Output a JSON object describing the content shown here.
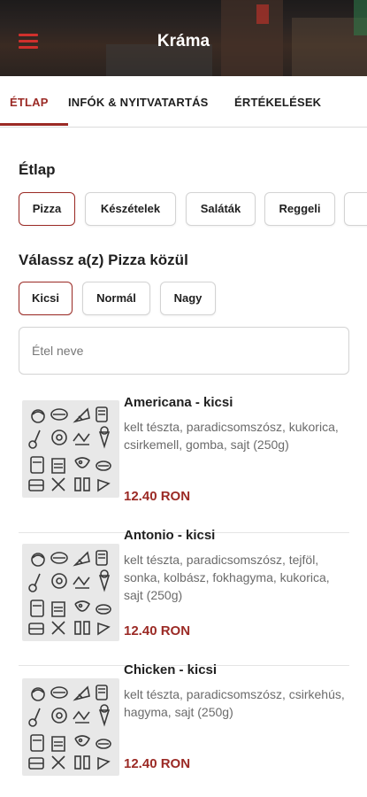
{
  "header": {
    "title": "Kráma",
    "menu_icon": "hamburger-menu-icon"
  },
  "tabs": [
    {
      "label": "ÉTLAP",
      "active": true
    },
    {
      "label": "INFÓK & NYITVATARTÁS",
      "active": false
    },
    {
      "label": "ÉRTÉKELÉSEK",
      "active": false
    }
  ],
  "menu_section": {
    "title": "Étlap",
    "categories": [
      {
        "label": "Pizza",
        "selected": true
      },
      {
        "label": "Készételek",
        "selected": false
      },
      {
        "label": "Saláták",
        "selected": false
      },
      {
        "label": "Reggeli",
        "selected": false
      }
    ]
  },
  "size_section": {
    "title": "Válassz a(z) Pizza közül",
    "sizes": [
      {
        "label": "Kicsi",
        "selected": true
      },
      {
        "label": "Normál",
        "selected": false
      },
      {
        "label": "Nagy",
        "selected": false
      }
    ]
  },
  "search": {
    "placeholder": "Étel neve",
    "value": ""
  },
  "items": [
    {
      "name": "Americana - kicsi",
      "description": "kelt tészta, paradicsomszósz, kukorica, csirkemell, gomba, sajt (250g)",
      "price": "12.40 RON"
    },
    {
      "name": "Antonio - kicsi",
      "description": "kelt tészta, paradicsomszósz, tejföl, sonka, kolbász, fokhagyma, kukorica, sajt (250g)",
      "price": "12.40 RON"
    },
    {
      "name": "Chicken - kicsi",
      "description": "kelt tészta, paradicsomszósz, csirkehús, hagyma, sajt (250g)",
      "price": "12.40 RON"
    }
  ],
  "colors": {
    "accent": "#9b2a25",
    "border": "#d3d3d3",
    "muted_text": "#6b6b6b"
  }
}
